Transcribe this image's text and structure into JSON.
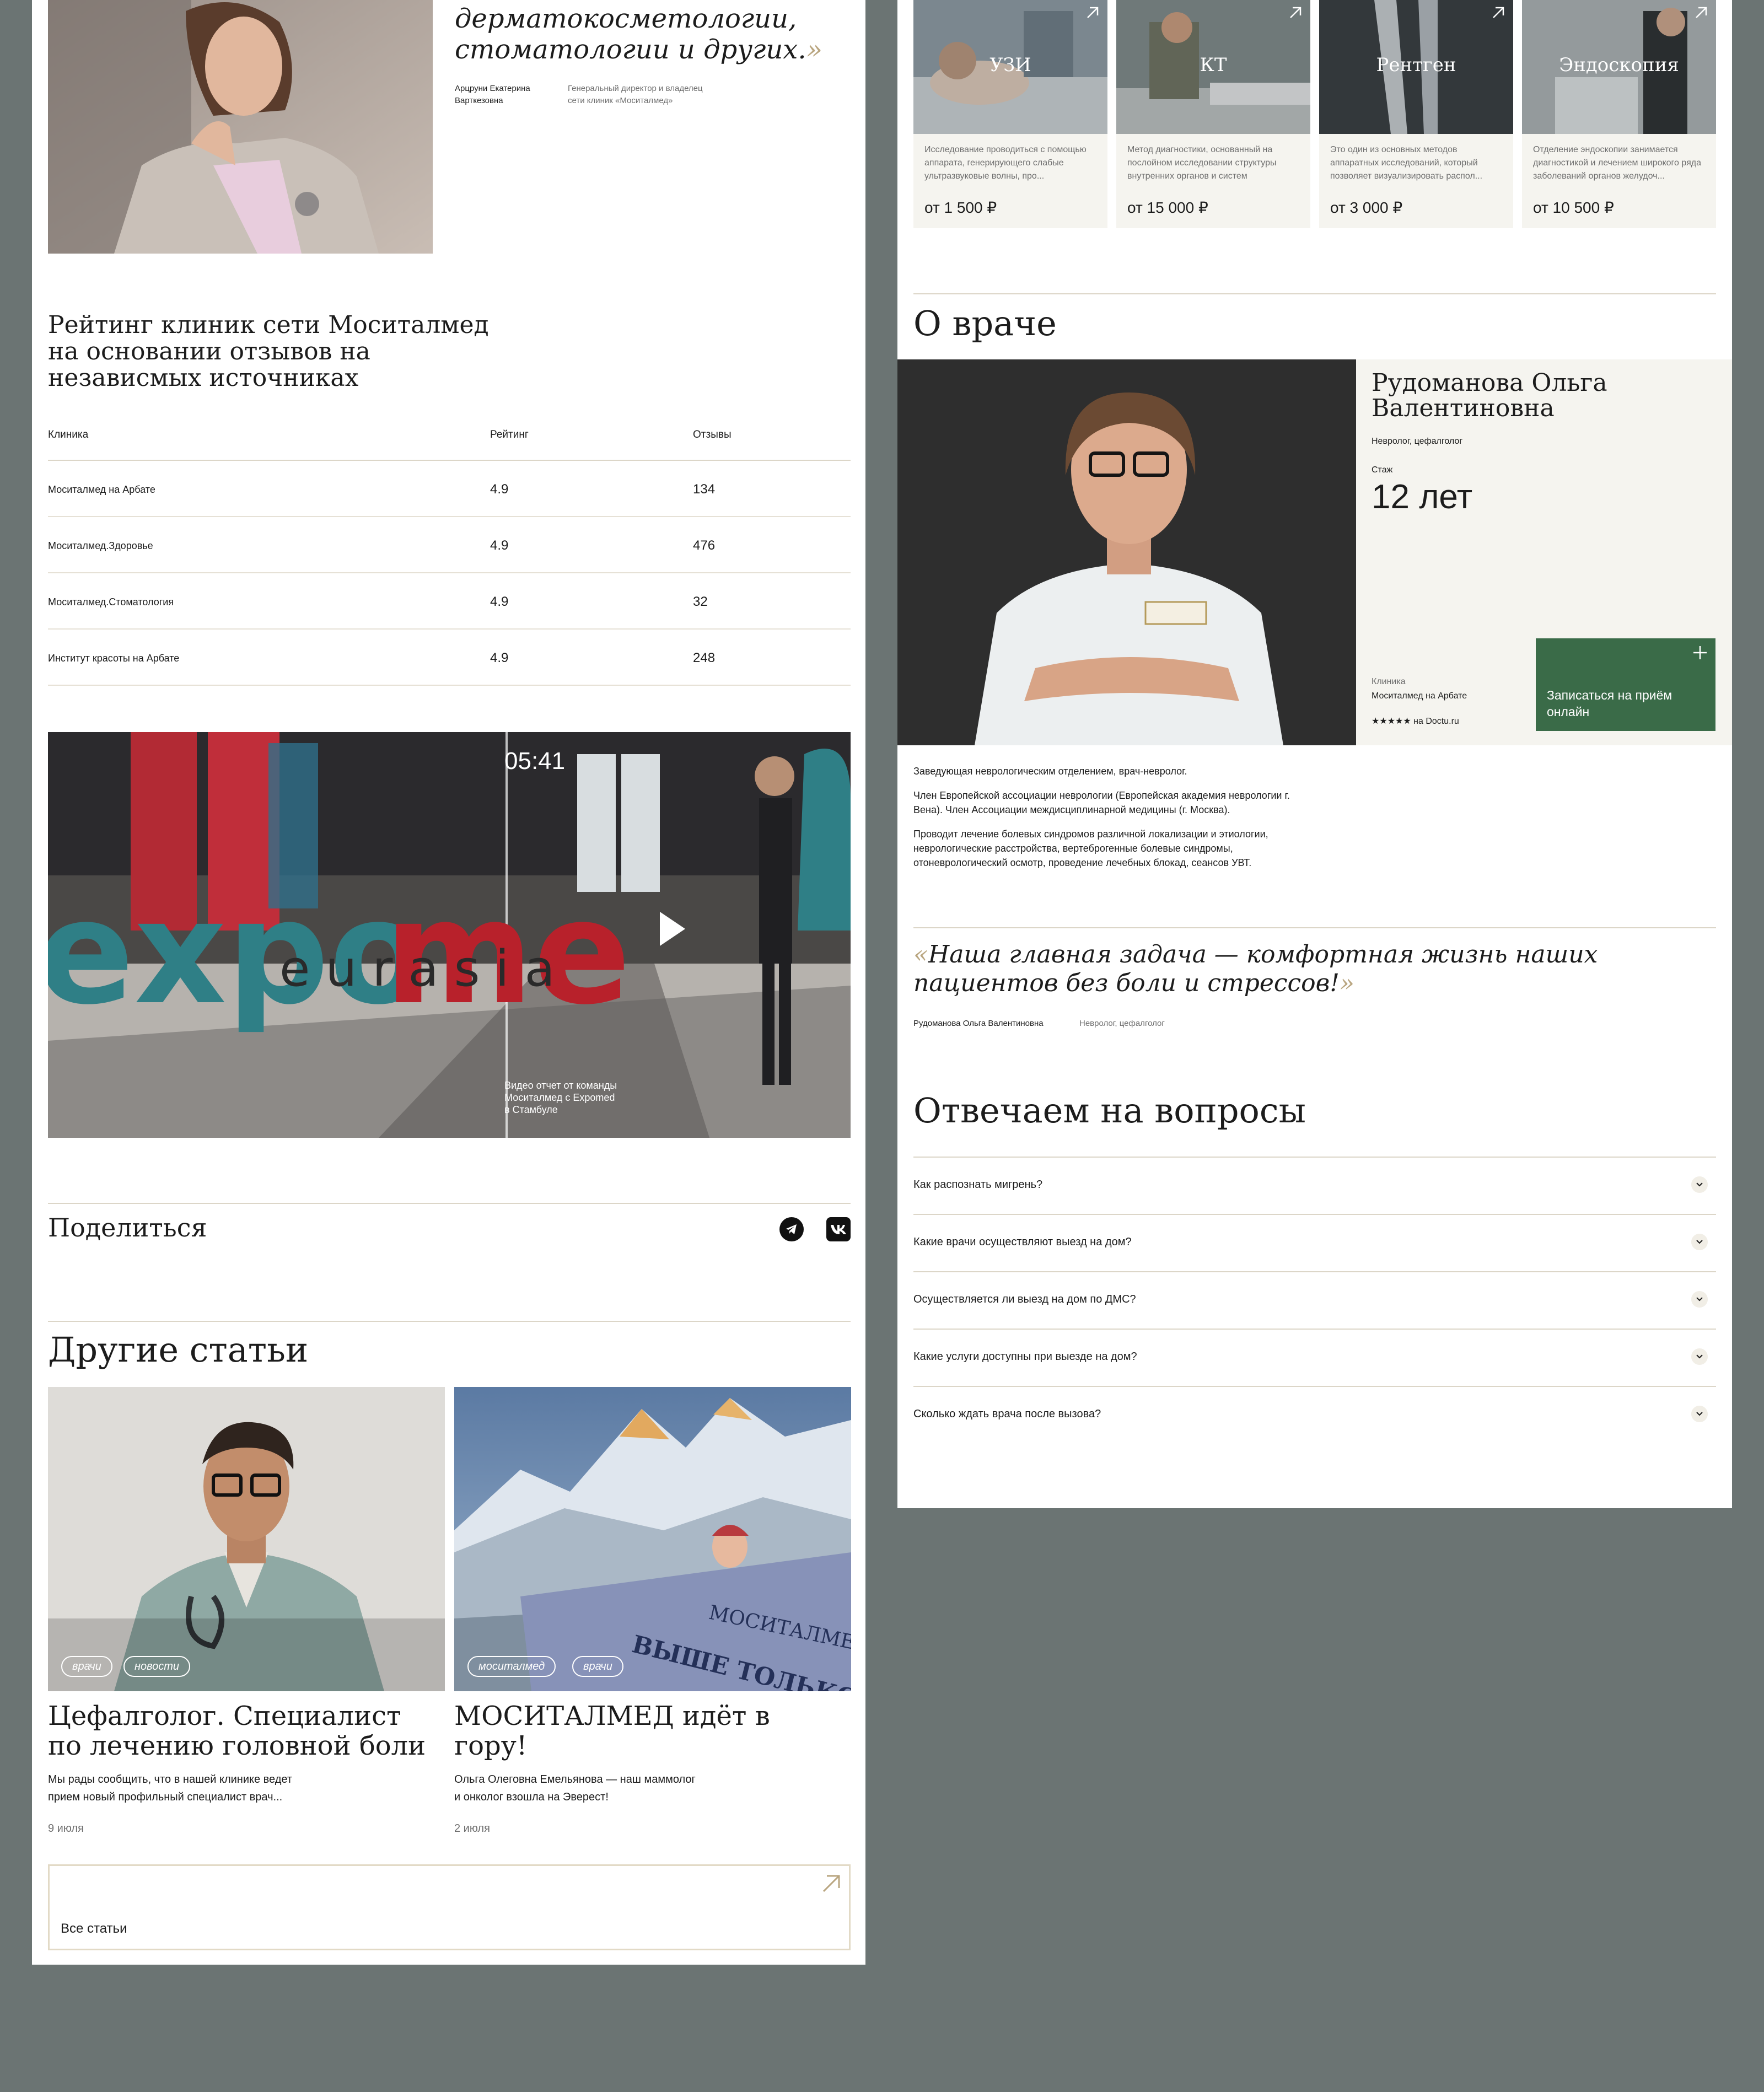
{
  "quote_block": {
    "text_line1": "дерматокосметологии,",
    "text_line2": "стоматологии и других.",
    "close_mark": "»",
    "author_name_line1": "Арцруни Екатерина",
    "author_name_line2": "Варткезовна",
    "author_role_line1": "Генеральный директор и владелец",
    "author_role_line2": "сети клиник «Моситалмед»"
  },
  "rating": {
    "title_line1": "Рейтинг клиник сети Моситалмед",
    "title_line2": "на основании отзывов на",
    "title_line3": "независмых источниках",
    "headers": [
      "Клиника",
      "Рейтинг",
      "Отзывы"
    ],
    "rows": [
      {
        "name": "Моситалмед на Арбате",
        "rating": "4.9",
        "reviews": "134"
      },
      {
        "name": "Моситалмед.Здоровье",
        "rating": "4.9",
        "reviews": "476"
      },
      {
        "name": "Моситалмед.Стоматология",
        "rating": "4.9",
        "reviews": "32"
      },
      {
        "name": "Институт красоты на Арбате",
        "rating": "4.9",
        "reviews": "248"
      }
    ]
  },
  "video": {
    "time": "05:41",
    "caption_line1": "Видео отчет от команды",
    "caption_line2": "Моситалмед с Expomed",
    "caption_line3": "в Стамбуле",
    "sign_main": "expomed",
    "sign_sub": "eurasia"
  },
  "share": {
    "title": "Поделиться",
    "telegram_icon": "telegram-icon",
    "vk_icon": "vk-icon"
  },
  "other_articles": {
    "title": "Другие статьи",
    "items": [
      {
        "tags": [
          "врачи",
          "новости"
        ],
        "title_line1": "Цефалголог. Специалист",
        "title_line2": "по лечению головной боли",
        "text_line1": "Мы рады сообщить, что в нашей клинике ведет",
        "text_line2": "прием новый профильный специалист врач...",
        "date": "9 июля"
      },
      {
        "tags": [
          "моситалмед",
          "врачи"
        ],
        "title_line1": "МОСИТАЛМЕД идёт в",
        "title_line2": "гору!",
        "text_line1": "Ольга Олеговна Емельянова — наш маммолог",
        "text_line2": "и онколог взошла на Эверест!",
        "date": "2 июля",
        "banner_line1": "МОСИТАЛМЕД",
        "banner_line2": "ВЫШЕ ТОЛЬКО"
      }
    ],
    "all_label": "Все статьи"
  },
  "services": [
    {
      "label": "УЗИ",
      "desc": "Исследование проводиться с помощью аппарата, генерирующего слабые ультразвуковые волны, про...",
      "price": "от 1 500 ₽"
    },
    {
      "label": "КТ",
      "desc": "Метод диагностики, основанный на послойном исследовании структуры внутренних органов и систем",
      "price": "от 15 000 ₽"
    },
    {
      "label": "Рентген",
      "desc": "Это один из основных методов аппаратных исследований, который позволяет визуализировать распол...",
      "price": "от 3 000 ₽"
    },
    {
      "label": "Эндоскопия",
      "desc": "Отделение эндоскопии занимается диагностикой и лечением широкого ряда заболеваний органов желудоч...",
      "price": "от 10 500 ₽"
    }
  ],
  "doctor": {
    "section_title": "О враче",
    "name_line1": "Рудоманова Ольга",
    "name_line2": "Валентиновна",
    "specialty": "Невролог, цефалголог",
    "experience_label": "Стаж",
    "experience_value": "12 лет",
    "clinic_label": "Клиника",
    "clinic_name": "Моситалмед на Арбате",
    "stars": "★★★★★",
    "rating_source": "на Doctu.ru",
    "book_line1": "Записаться на приём",
    "book_line2": "онлайн",
    "bio_p1": "Заведующая неврологическим отделением, врач-невролог.",
    "bio_p2_line1": "Член Европейской ассоциации неврологии (Европейская академия неврологии г.",
    "bio_p2_line2": "Вена). Член Ассоциации междисциплинарной медицины (г. Москва).",
    "bio_p3_line1": "Проводит лечение болевых синдромов различной локализации и этиологии,",
    "bio_p3_line2": "неврологические расстройства, вертеброгенные болевые синдромы,",
    "bio_p3_line3": "отоневрологический осмотр, проведение лечебных блокад, сеансов УВТ.",
    "quote_open": "«",
    "quote_line1": "Наша главная задача — комфортная жизнь наших",
    "quote_line2": "пациентов без боли и стрессов!",
    "quote_close": "»",
    "quote_author": "Рудоманова Ольга Валентиновна",
    "quote_role": "Невролог, цефалголог"
  },
  "faq": {
    "title": "Отвечаем на вопросы",
    "items": [
      "Как распознать мигрень?",
      "Какие врачи осуществляют выезд на дом?",
      "Осуществляется ли выезд на дом по ДМС?",
      "Какие услуги доступны при выезде на дом?",
      "Сколько ждать врача после вызова?"
    ]
  }
}
